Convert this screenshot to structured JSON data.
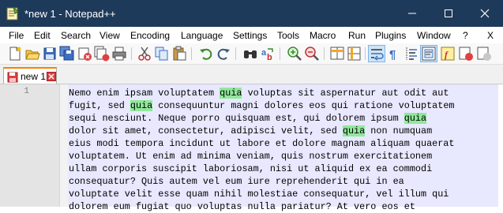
{
  "window": {
    "title": "*new 1 - Notepad++",
    "app_icon": "notepadpp-icon",
    "colors": {
      "titlebar": "#1e3a5a",
      "tab_accent": "#ff8000",
      "highlight": "#90e89a",
      "current_line": "#e8e8ff"
    }
  },
  "menu": [
    "File",
    "Edit",
    "Search",
    "View",
    "Encoding",
    "Language",
    "Settings",
    "Tools",
    "Macro",
    "Run",
    "Plugins",
    "Window",
    "?"
  ],
  "menu_close": "X",
  "toolbar_icons": [
    "new-file-icon",
    "open-file-icon",
    "save-icon",
    "save-all-icon",
    "close-icon",
    "close-all-icon",
    "print-icon",
    "cut-icon",
    "copy-icon",
    "paste-icon",
    "undo-icon",
    "redo-icon",
    "find-icon",
    "replace-icon",
    "zoom-in-icon",
    "zoom-out-icon",
    "sync-vertical-icon",
    "sync-horizontal-icon",
    "word-wrap-icon",
    "show-all-chars-icon",
    "indent-guide-icon",
    "doc-map-icon",
    "function-list-icon",
    "macro-record-icon"
  ],
  "tabs": [
    {
      "label": "new 1",
      "modified": true
    }
  ],
  "editor": {
    "line_number": "1",
    "highlight_word": "quia",
    "lines": [
      [
        {
          "t": "Nemo enim ipsam voluptatem "
        },
        {
          "t": "quia",
          "hl": true
        },
        {
          "t": " voluptas sit aspernatur aut odit aut"
        }
      ],
      [
        {
          "t": "fugit, sed "
        },
        {
          "t": "quia",
          "hl": true
        },
        {
          "t": " consequuntur magni dolores eos qui ratione voluptatem"
        }
      ],
      [
        {
          "t": "sequi nesciunt. Neque porro quisquam est, qui dolorem ipsum "
        },
        {
          "t": "quia",
          "hl": true
        }
      ],
      [
        {
          "t": "dolor sit amet, consectetur, adipisci velit, sed "
        },
        {
          "t": "quia",
          "hl": true
        },
        {
          "t": " non numquam"
        }
      ],
      [
        {
          "t": "eius modi tempora incidunt ut labore et dolore magnam aliquam quaerat"
        }
      ],
      [
        {
          "t": "voluptatem. Ut enim ad minima veniam, quis nostrum exercitationem"
        }
      ],
      [
        {
          "t": "ullam corporis suscipit laboriosam, nisi ut aliquid ex ea commodi"
        }
      ],
      [
        {
          "t": "consequatur? Quis autem vel eum iure reprehenderit qui in ea"
        }
      ],
      [
        {
          "t": "voluptate velit esse quam nihil molestiae consequatur, vel illum qui"
        }
      ],
      [
        {
          "t": "dolorem eum fugiat quo voluptas nulla pariatur? At vero eos et"
        }
      ]
    ]
  }
}
